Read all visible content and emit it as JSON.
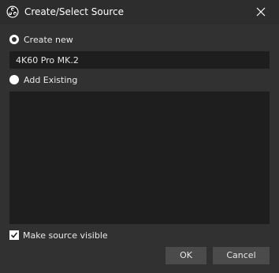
{
  "window": {
    "title": "Create/Select Source",
    "app_icon": "obs-logo-icon",
    "close_icon": "close-icon"
  },
  "options": {
    "create_new_label": "Create new",
    "create_new_selected": true,
    "add_existing_label": "Add Existing",
    "add_existing_selected": false
  },
  "name_input": {
    "value": "4K60 Pro MK.2"
  },
  "existing_sources": [],
  "visible_checkbox": {
    "label": "Make source visible",
    "checked": true
  },
  "buttons": {
    "ok_label": "OK",
    "cancel_label": "Cancel"
  },
  "colors": {
    "background": "#313131",
    "input_background": "#1e1e1e",
    "button_background": "#4b4b4b"
  }
}
